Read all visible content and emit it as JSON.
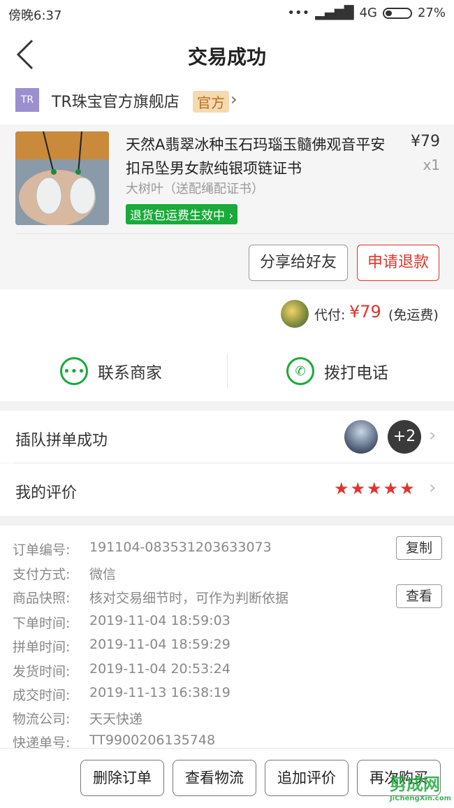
{
  "status_bar": {
    "time": "傍晚6:37",
    "network": "4G",
    "battery": "27%",
    "battery_level": 0.27
  },
  "nav": {
    "title": "交易成功",
    "back_icon": "chevron-left-icon"
  },
  "store": {
    "logo_text": "TR",
    "name": "TR珠宝官方旗舰店",
    "badge": "官方"
  },
  "product": {
    "title": "天然A翡翠冰种玉石玛瑙玉髓佛观音平安扣吊坠男女款纯银项链证书",
    "price": "¥79",
    "qty": "x1",
    "spec": "大树叶（送配绳配证书）",
    "return_tag": "退货包运费生效中"
  },
  "actions": {
    "share": "分享给好友",
    "refund": "申请退款"
  },
  "payment": {
    "label": "代付:",
    "amount": "¥79",
    "note": "(免运费)"
  },
  "contact": {
    "merchant": "联系商家",
    "call": "拨打电话"
  },
  "group": {
    "label": "插队拼单成功",
    "more": "+2"
  },
  "review": {
    "label": "我的评价",
    "stars": "★★★★★",
    "rating": 5
  },
  "details": {
    "rows": [
      {
        "label": "订单编号:",
        "value": "191104-083531203633073"
      },
      {
        "label": "支付方式:",
        "value": "微信"
      },
      {
        "label": "商品快照:",
        "value": "核对交易细节时，可作为判断依据"
      },
      {
        "label": "下单时间:",
        "value": "2019-11-04 18:59:03"
      },
      {
        "label": "拼单时间:",
        "value": "2019-11-04 18:59:29"
      },
      {
        "label": "发货时间:",
        "value": "2019-11-04 20:53:24"
      },
      {
        "label": "成交时间:",
        "value": "2019-11-13 16:38:19"
      },
      {
        "label": "物流公司:",
        "value": "天天快递"
      },
      {
        "label": "快递单号:",
        "value": "TT9900206135748"
      }
    ],
    "copy": "复制",
    "view": "查看"
  },
  "bottom": {
    "delete": "删除订单",
    "logistics": "查看物流",
    "add_review": "追加评价",
    "rebuy": "再次购买"
  },
  "watermark": {
    "text": "剪成网",
    "sub": "JiChengXin.com"
  }
}
